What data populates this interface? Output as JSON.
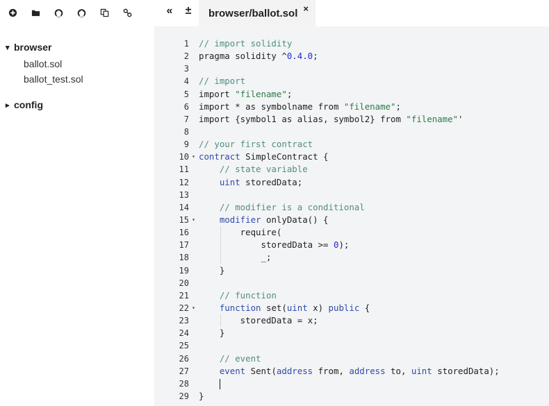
{
  "toolbar": {
    "buttons": [
      {
        "name": "create-new-file-button",
        "icon": "plus-circle-icon"
      },
      {
        "name": "open-folder-button",
        "icon": "folder-icon"
      },
      {
        "name": "publish-gist-button",
        "icon": "github-icon"
      },
      {
        "name": "update-gist-button",
        "icon": "github-alt-icon"
      },
      {
        "name": "copy-files-button",
        "icon": "copy-icon"
      },
      {
        "name": "connect-localhost-button",
        "icon": "link-icon"
      }
    ]
  },
  "file_tree": {
    "folders": [
      {
        "label": "browser",
        "expanded": true,
        "files": [
          "ballot.sol",
          "ballot_test.sol"
        ]
      },
      {
        "label": "config",
        "expanded": false,
        "files": []
      }
    ]
  },
  "tabs": {
    "collapse_icon": "«",
    "increase_font_icon": "±",
    "active_tab_label": "browser/ballot.sol",
    "close_label": "×"
  },
  "editor": {
    "line_numbers": [
      "1",
      "2",
      "3",
      "4",
      "5",
      "6",
      "7",
      "8",
      "9",
      "10",
      "11",
      "12",
      "13",
      "14",
      "15",
      "16",
      "17",
      "18",
      "19",
      "20",
      "21",
      "22",
      "23",
      "24",
      "25",
      "26",
      "27",
      "28",
      "29"
    ],
    "fold_lines": [
      10,
      15,
      22
    ],
    "lines": [
      [
        [
          "comment",
          "// import solidity"
        ]
      ],
      [
        [
          "plain",
          "pragma solidity ^"
        ],
        [
          "number",
          "0.4.0"
        ],
        [
          "plain",
          ";"
        ]
      ],
      [],
      [
        [
          "comment",
          "// import"
        ]
      ],
      [
        [
          "plain",
          "import "
        ],
        [
          "string",
          "\"filename\""
        ],
        [
          "plain",
          ";"
        ]
      ],
      [
        [
          "plain",
          "import * as symbolname from "
        ],
        [
          "string",
          "\"filename\""
        ],
        [
          "plain",
          ";"
        ]
      ],
      [
        [
          "plain",
          "import {symbol1 as alias, symbol2} from "
        ],
        [
          "string",
          "\"filename\""
        ],
        [
          "plain",
          "'"
        ]
      ],
      [],
      [
        [
          "comment",
          "// your first contract"
        ]
      ],
      [
        [
          "keyword",
          "contract"
        ],
        [
          "plain",
          " SimpleContract {"
        ]
      ],
      [
        [
          "plain",
          "    "
        ],
        [
          "comment",
          "// state variable"
        ]
      ],
      [
        [
          "plain",
          "    "
        ],
        [
          "keyword",
          "uint"
        ],
        [
          "plain",
          " storedData;"
        ]
      ],
      [],
      [
        [
          "plain",
          "    "
        ],
        [
          "comment",
          "// modifier is a conditional"
        ]
      ],
      [
        [
          "plain",
          "    "
        ],
        [
          "keyword",
          "modifier"
        ],
        [
          "plain",
          " onlyData() {"
        ]
      ],
      [
        [
          "plain",
          "        require("
        ]
      ],
      [
        [
          "plain",
          "            storedData >= "
        ],
        [
          "number",
          "0"
        ],
        [
          "plain",
          ");"
        ]
      ],
      [
        [
          "plain",
          "            _;"
        ]
      ],
      [
        [
          "plain",
          "    }"
        ]
      ],
      [],
      [
        [
          "plain",
          "    "
        ],
        [
          "comment",
          "// function"
        ]
      ],
      [
        [
          "plain",
          "    "
        ],
        [
          "keyword",
          "function"
        ],
        [
          "plain",
          " set("
        ],
        [
          "keyword",
          "uint"
        ],
        [
          "plain",
          " x) "
        ],
        [
          "keyword",
          "public"
        ],
        [
          "plain",
          " {"
        ]
      ],
      [
        [
          "plain",
          "        storedData = x;"
        ]
      ],
      [
        [
          "plain",
          "    }"
        ]
      ],
      [],
      [
        [
          "plain",
          "    "
        ],
        [
          "comment",
          "// event"
        ]
      ],
      [
        [
          "plain",
          "    "
        ],
        [
          "keyword",
          "event"
        ],
        [
          "plain",
          " Sent("
        ],
        [
          "keyword",
          "address"
        ],
        [
          "plain",
          " from, "
        ],
        [
          "keyword",
          "address"
        ],
        [
          "plain",
          " to, "
        ],
        [
          "keyword",
          "uint"
        ],
        [
          "plain",
          " storedData);"
        ]
      ],
      [
        [
          "plain",
          "    "
        ]
      ],
      [
        [
          "plain",
          "}"
        ]
      ]
    ],
    "cursor_line": 28
  }
}
